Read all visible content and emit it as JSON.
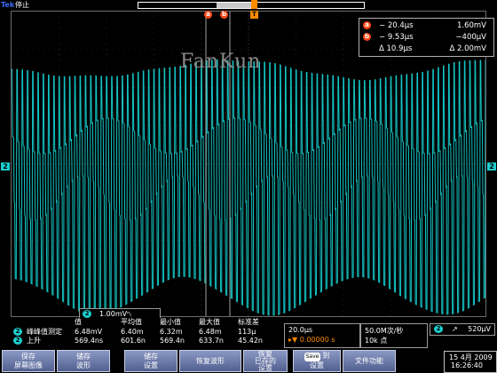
{
  "status": {
    "brand": "Tek",
    "run_state": "停止"
  },
  "watermark": "FanKun",
  "markers": {
    "cursor_a": "a",
    "cursor_b": "b",
    "trigger": "T",
    "channel": "2"
  },
  "cursor_readout": {
    "rows": [
      {
        "badge": "a",
        "time": "− 20.4μs",
        "value": "1.60mV"
      },
      {
        "badge": "b",
        "time": "− 9.53μs",
        "value": "−400μV"
      },
      {
        "badge": "",
        "time": "Δ 10.9μs",
        "value": "Δ 2.00mV"
      }
    ]
  },
  "channel_scale": {
    "channel": "2",
    "text": "1.00mVⁿ₍"
  },
  "measurements": {
    "headers": [
      "值",
      "平均值",
      "最小值",
      "最大值",
      "标准差"
    ],
    "rows": [
      {
        "channel": "2",
        "name": "峰峰值测定",
        "values": [
          "6.48mV",
          "6.40m",
          "6.32m",
          "6.48m",
          "113μ"
        ]
      },
      {
        "channel": "2",
        "name": "上升",
        "values": [
          "569.4ns",
          "601.6n",
          "569.4n",
          "633.7n",
          "45.42n"
        ]
      }
    ]
  },
  "horizontal": {
    "scale": "20.0μs",
    "trigger_pos": "▸▼ 0.00000 s"
  },
  "acquisition": {
    "rate": "50.0M次/秒",
    "points": "10k 点"
  },
  "trigger": {
    "channel": "2",
    "slope": "↗",
    "level": "520μV"
  },
  "buttons": [
    {
      "line1": "保存",
      "line2": "屏幕图像"
    },
    {
      "line1": "储存",
      "line2": "波形"
    },
    {
      "line1": "储存",
      "line2": "设置"
    },
    {
      "line1": "恢复波形",
      "line2": ""
    },
    {
      "line1": "恢复",
      "line2": "已存的",
      "line3": "设置"
    },
    {
      "badge": "Save",
      "line1": "到",
      "line2": "设置"
    },
    {
      "line1": "文件功能",
      "line2": ""
    }
  ],
  "datetime": {
    "date": "15 4月 2009",
    "time": "16:26:40"
  },
  "colors": {
    "trace": "#15c4c4",
    "cursor": "#ff4a18",
    "trigger": "#ff8a00",
    "brand": "#3a6cff"
  }
}
